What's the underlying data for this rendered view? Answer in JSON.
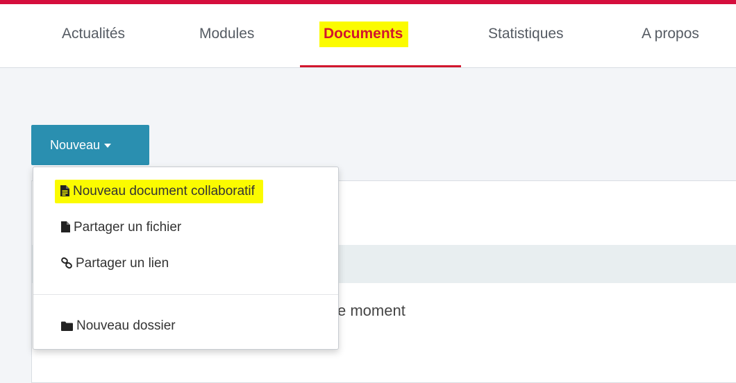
{
  "nav": {
    "tabs": [
      {
        "label": "Actualités"
      },
      {
        "label": "Modules"
      },
      {
        "label": "Documents"
      },
      {
        "label": "Statistiques"
      },
      {
        "label": "A propos"
      }
    ]
  },
  "toolbar": {
    "new_label": "Nouveau"
  },
  "dropdown": {
    "items": [
      {
        "label": "Nouveau document collaboratif",
        "icon": "document-text-icon"
      },
      {
        "label": "Partager un fichier",
        "icon": "file-icon"
      },
      {
        "label": "Partager un lien",
        "icon": "link-icon"
      },
      {
        "label": "Nouveau dossier",
        "icon": "folder-icon"
      }
    ]
  },
  "content": {
    "empty_text_fragment": "e moment"
  },
  "colors": {
    "accent": "#d2162e",
    "button": "#2a8fb0",
    "highlight": "#fbfb00"
  }
}
